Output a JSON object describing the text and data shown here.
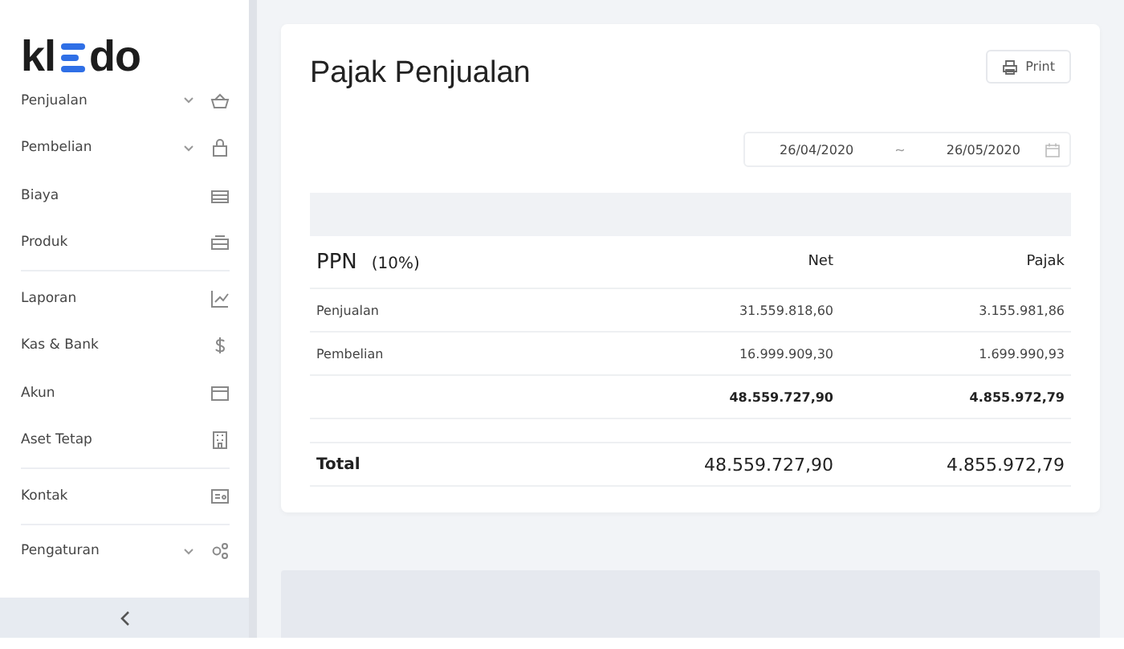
{
  "logo": {
    "left": "kl",
    "right": "do"
  },
  "sidebar": {
    "groups": [
      {
        "items": [
          {
            "label": "Penjualan",
            "has_submenu": true
          },
          {
            "label": "Pembelian",
            "has_submenu": true
          },
          {
            "label": "Biaya",
            "has_submenu": false
          },
          {
            "label": "Produk",
            "has_submenu": false
          }
        ]
      },
      {
        "items": [
          {
            "label": "Laporan",
            "has_submenu": false
          },
          {
            "label": "Kas & Bank",
            "has_submenu": false
          },
          {
            "label": "Akun",
            "has_submenu": false
          },
          {
            "label": "Aset Tetap",
            "has_submenu": false
          }
        ]
      },
      {
        "items": [
          {
            "label": "Kontak",
            "has_submenu": false
          }
        ]
      },
      {
        "items": [
          {
            "label": "Pengaturan",
            "has_submenu": true
          }
        ]
      }
    ]
  },
  "page": {
    "title": "Pajak Penjualan",
    "print_button": "Print",
    "date_range": {
      "start": "26/04/2020",
      "separator": "~",
      "end": "26/05/2020"
    }
  },
  "table": {
    "tax_name": "PPN",
    "tax_rate": "(10%)",
    "columns": [
      "Net",
      "Pajak"
    ],
    "rows": [
      {
        "label": "Penjualan",
        "net": "31.559.818,60",
        "tax": "3.155.981,86"
      },
      {
        "label": "Pembelian",
        "net": "16.999.909,30",
        "tax": "1.699.990,93"
      }
    ],
    "subtotal": {
      "net": "48.559.727,90",
      "tax": "4.855.972,79"
    },
    "total": {
      "label": "Total",
      "net": "48.559.727,90",
      "tax": "4.855.972,79"
    }
  }
}
